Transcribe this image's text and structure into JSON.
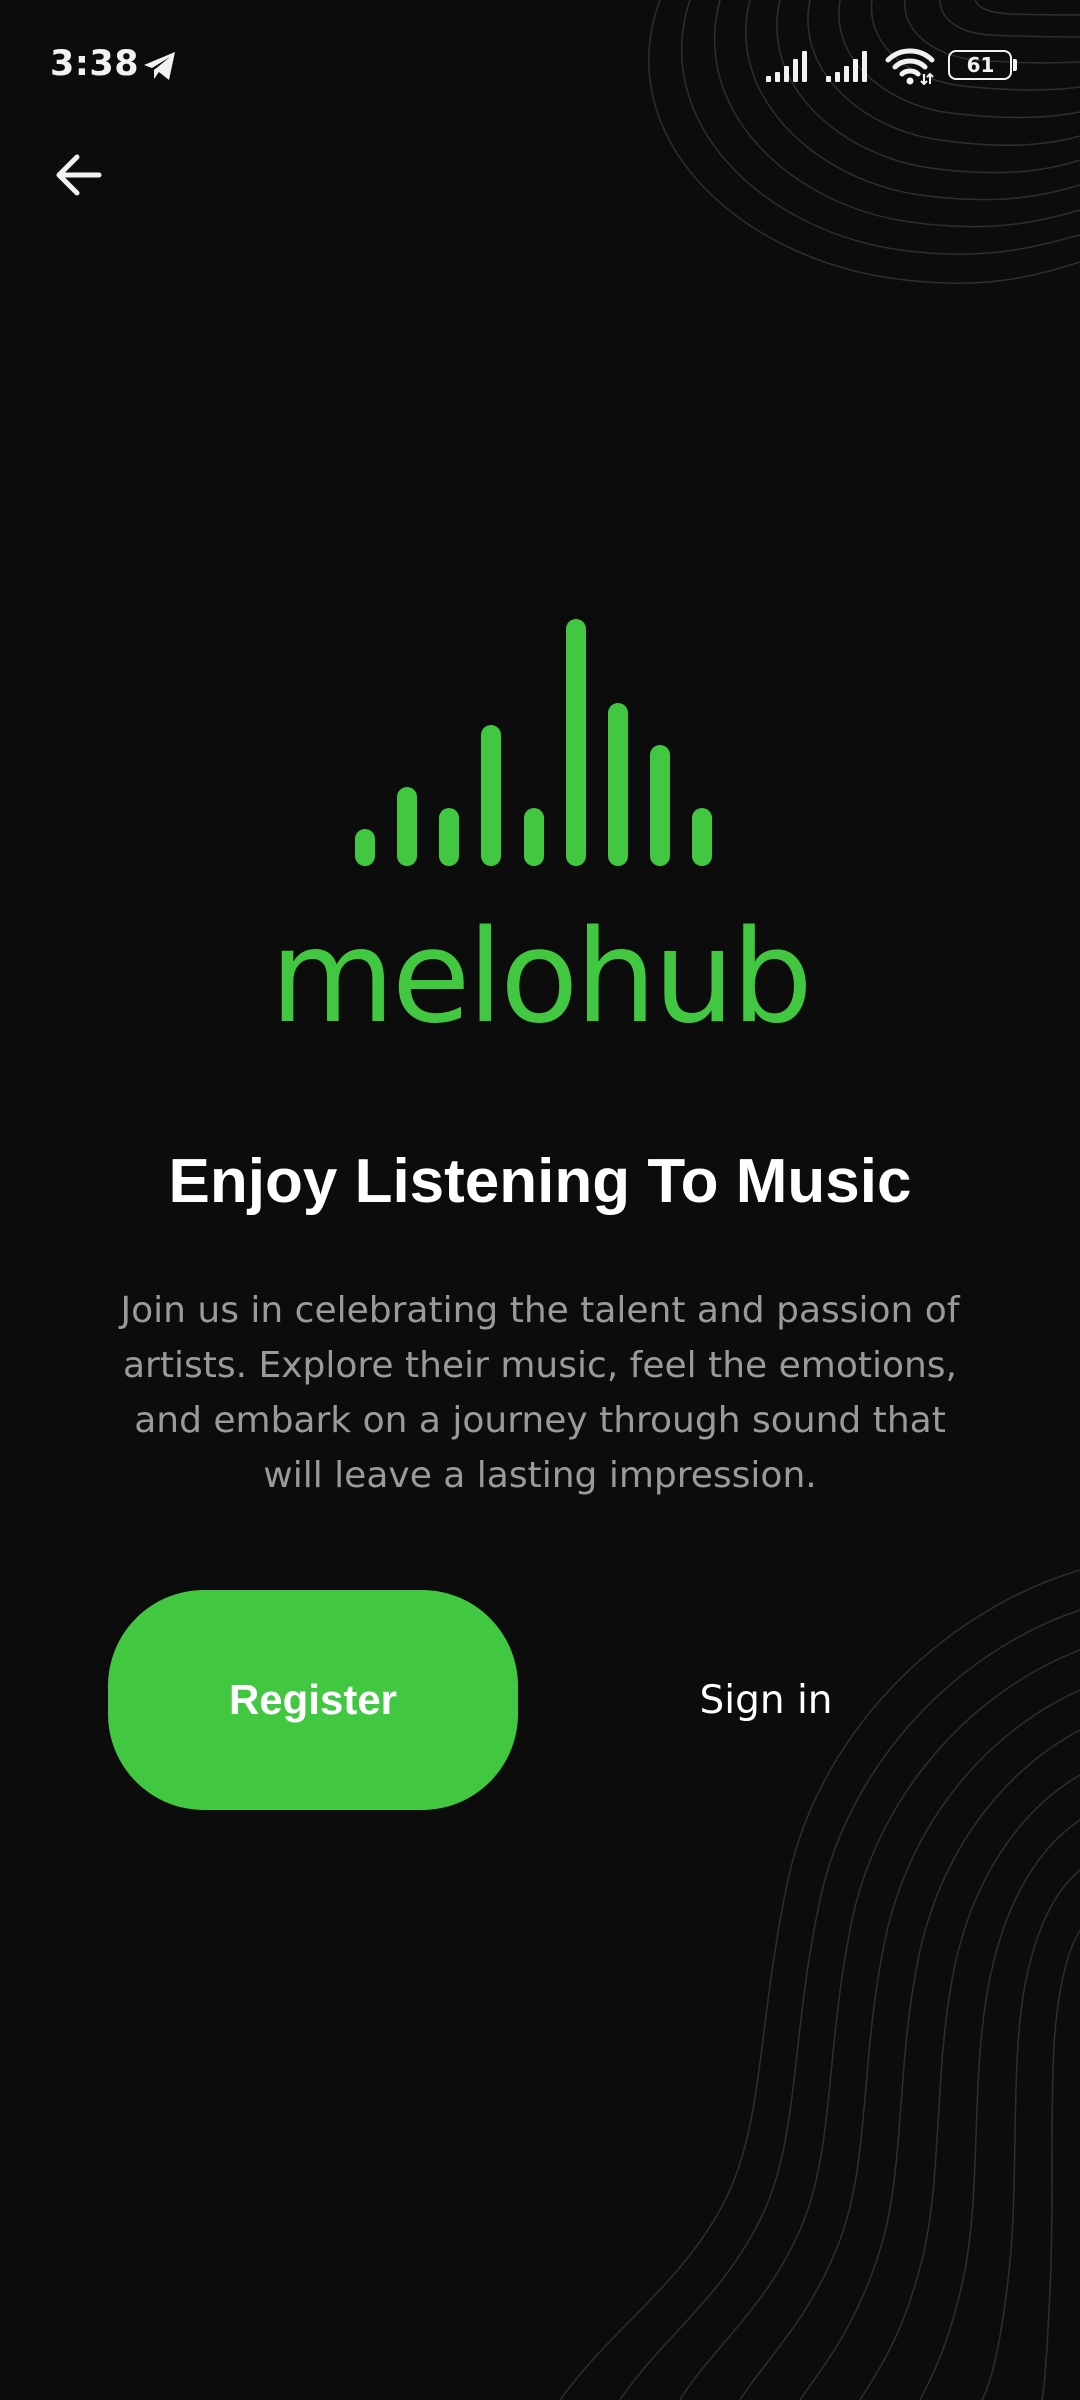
{
  "status_bar": {
    "time": "3:38",
    "battery": "61",
    "icons": [
      "telegram-icon",
      "signal-icon",
      "signal-icon",
      "wifi-icon",
      "battery-icon"
    ]
  },
  "navigation": {
    "back_icon": "arrow-left-icon"
  },
  "brand": {
    "name": "melohub",
    "color": "#42c741",
    "logo_icon": "equalizer-bars-icon"
  },
  "hero": {
    "title": "Enjoy Listening To Music",
    "description": "Join us in celebrating the talent and passion of artists. Explore their music, feel the emotions, and embark on a journey through sound that will leave a lasting impression."
  },
  "actions": {
    "register_label": "Register",
    "signin_label": "Sign in"
  },
  "colors": {
    "background": "#0c0c0c",
    "accent": "#42c741",
    "text_primary": "#ffffff",
    "text_secondary": "#9a9a9a"
  }
}
